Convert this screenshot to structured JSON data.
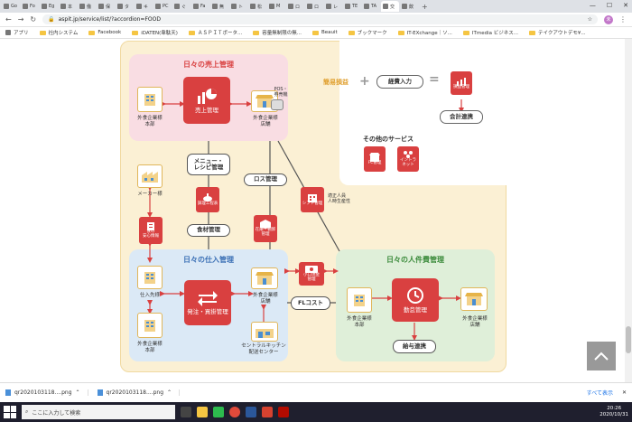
{
  "browser": {
    "tabs": [
      "Go",
      "Fo",
      "Eg",
      "本",
      "働",
      "保",
      "タ",
      "キ",
      "PC",
      "ぐ",
      "Fa",
      "無",
      "ト",
      "松",
      "M",
      "ロ",
      "ロ",
      "レ",
      "TE",
      "TA",
      "交",
      "飲"
    ],
    "active_tab_index": 20,
    "url": "aspit.jp/service/list/?accordion=FOOD",
    "avatar": "未",
    "bookmarks": [
      "アプリ",
      "社内システム",
      "Facebook",
      "iDATEN(韋駄天)",
      "ＡＳＰＩＴポータ...",
      "容量無制限の無...",
      "Beauit",
      "ブックマーク",
      "IT-EXchange｜ソ...",
      "ITmedia ビジネス...",
      "テイクアウトデモ¥..."
    ]
  },
  "diagram": {
    "sales": {
      "title": "日々の売上管理",
      "core": "売上管理",
      "left_label": "外食企業様\n本部",
      "right_label": "外食企業様\n店舗",
      "pos_label": "POS・\n券売機"
    },
    "top_right": {
      "simple_pl": "簡易損益",
      "plus": "+",
      "expense": "経費入力",
      "equals": "=",
      "pl_icon": "損益管理",
      "accounting": "会計連携",
      "other_services": "その他のサービス",
      "fc": "FC管理",
      "intranet": "イントラ\nネット"
    },
    "middle": {
      "menu_recipe": "メニュー・\nレシピ管理",
      "loss": "ロス管理",
      "maker": "メーカー様",
      "cooking": "調理工程表",
      "food_safety": "食の\n安心情報",
      "ingredients": "食材管理",
      "inventory": "在庫・棚卸\n管理",
      "shift": "シフト管理",
      "staffing": "適正人員\n人時生産性",
      "petty_cash": "小口現金\n管理",
      "fl_cost": "FLコスト"
    },
    "purchase": {
      "title": "日々の仕入管理",
      "core": "発注・買掛管理",
      "supplier": "仕入先様",
      "hq": "外食企業様\n本部",
      "store": "外食企業様\n店舗",
      "central_kitchen": "セントラルキッチン\n配送センター"
    },
    "labor": {
      "title": "日々の人件費管理",
      "core": "勤怠管理",
      "hq": "外食企業様\n本部",
      "store": "外食企業様\n店舗",
      "payroll": "給与連携"
    },
    "colors": {
      "pink": "#f9dde3",
      "blue": "#dbe9f6",
      "green": "#dfefd9",
      "beige": "#fbf0d4",
      "red": "#d94040"
    }
  },
  "downloads": {
    "items": [
      "qr2020103118....png",
      "qr2020103118....png"
    ],
    "show_all": "すべて表示"
  },
  "taskbar": {
    "search": "ここに入力して検索",
    "time": "20:26",
    "date": "2020/10/31"
  }
}
